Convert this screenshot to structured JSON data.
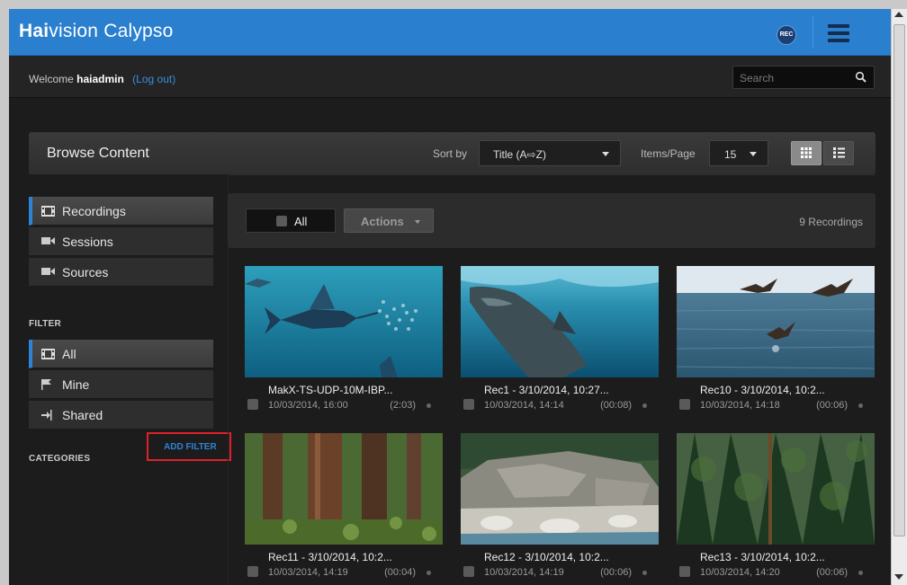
{
  "app": {
    "logo_bold": "Hai",
    "logo_rest": "vision Calypso",
    "rec_label": "REC"
  },
  "welcome": {
    "prefix": "Welcome",
    "username": "haiadmin",
    "logout": "(Log out)"
  },
  "search": {
    "placeholder": "Search"
  },
  "browse": {
    "title": "Browse Content",
    "sort_label": "Sort by",
    "sort_value": "Title (A⇨Z)",
    "ipp_label": "Items/Page",
    "ipp_value": "15"
  },
  "sidebar": {
    "nav": [
      {
        "label": "Recordings",
        "icon": "film-icon"
      },
      {
        "label": "Sessions",
        "icon": "camera-icon"
      },
      {
        "label": "Sources",
        "icon": "camera-icon"
      }
    ],
    "filter_label": "FILTER",
    "filters": [
      {
        "label": "All",
        "icon": "film-icon"
      },
      {
        "label": "Mine",
        "icon": "flag-icon"
      },
      {
        "label": "Shared",
        "icon": "share-icon"
      }
    ],
    "categories_label": "CATEGORIES",
    "add_filter": "ADD FILTER"
  },
  "toolbar": {
    "all_label": "All",
    "actions_label": "Actions",
    "count": "9 Recordings"
  },
  "recordings": [
    {
      "title": "MakX-TS-UDP-10M-IBP...",
      "date": "10/03/2014, 16:00",
      "duration": "(2:03)"
    },
    {
      "title": "Rec1 - 3/10/2014, 10:27...",
      "date": "10/03/2014, 14:14",
      "duration": "(00:08)"
    },
    {
      "title": "Rec10 - 3/10/2014, 10:2...",
      "date": "10/03/2014, 14:18",
      "duration": "(00:06)"
    },
    {
      "title": "Rec11 - 3/10/2014, 10:2...",
      "date": "10/03/2014, 14:19",
      "duration": "(00:04)"
    },
    {
      "title": "Rec12 - 3/10/2014, 10:2...",
      "date": "10/03/2014, 14:19",
      "duration": "(00:06)"
    },
    {
      "title": "Rec13 - 3/10/2014, 10:2...",
      "date": "10/03/2014, 14:20",
      "duration": "(00:06)"
    }
  ],
  "colors": {
    "brand_blue": "#2a7fce",
    "accent_blue": "#2f83d6",
    "highlight_red": "#e0202a"
  }
}
